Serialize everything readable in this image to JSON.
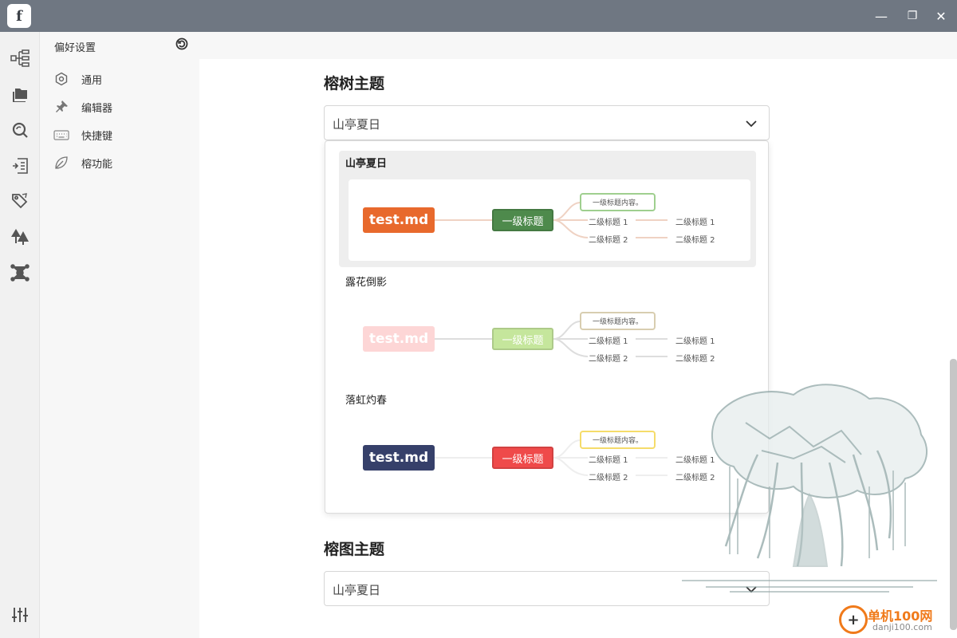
{
  "window": {
    "logo_letter": "f",
    "minimize": "—",
    "restore": "❐",
    "close": "✕"
  },
  "rail": {
    "icons": [
      "outline-tree-icon",
      "folders-icon",
      "search-refresh-icon",
      "outline-doc-icon",
      "tag-icon",
      "forest-icon",
      "graph-icon",
      "sliders-icon"
    ]
  },
  "sidebar": {
    "title": "偏好设置",
    "items": [
      {
        "label": "通用",
        "icon": "hexagon-gear-icon"
      },
      {
        "label": "编辑器",
        "icon": "pin-icon"
      },
      {
        "label": "快捷键",
        "icon": "keyboard-icon"
      },
      {
        "label": "榕功能",
        "icon": "leaf-icon"
      }
    ]
  },
  "main": {
    "tree_theme_title": "榕树主题",
    "tree_theme_value": "山亭夏日",
    "graph_theme_title": "榕图主题",
    "graph_theme_value": "山亭夏日"
  },
  "themes": [
    {
      "name": "山亭夏日",
      "selected": true,
      "root_label": "test.md",
      "root_color": "#e8692c",
      "h1_label": "一级标题",
      "h1_color": "#4e8a4c",
      "h1_text_color": "#ffffff",
      "content_label": "一级标题内容。",
      "content_border": "#9fcf8f",
      "line_color": "#efd2c3",
      "h2": [
        "二级标题 1",
        "二级标题 2"
      ],
      "h3": [
        "二级标题 1",
        "二级标题 2"
      ]
    },
    {
      "name": "露花倒影",
      "selected": false,
      "root_label": "test.md",
      "root_color": "#fdd6d6",
      "h1_label": "一级标题",
      "h1_color": "#c5e69c",
      "h1_text_color": "#ffffff",
      "content_label": "一级标题内容。",
      "content_border": "#d8cdb0",
      "line_color": "#dddddd",
      "h2": [
        "二级标题 1",
        "二级标题 2"
      ],
      "h3": [
        "二级标题 1",
        "二级标题 2"
      ]
    },
    {
      "name": "落虹灼春",
      "selected": false,
      "root_label": "test.md",
      "root_color": "#36406a",
      "h1_label": "一级标题",
      "h1_color": "#ef4a4a",
      "h1_text_color": "#ffffff",
      "content_label": "一级标题内容。",
      "content_border": "#f5dc6a",
      "line_color": "#eeeeee",
      "h2": [
        "二级标题 1",
        "二级标题 2"
      ],
      "h3": [
        "二级标题 1",
        "二级标题 2"
      ]
    }
  ],
  "brand": {
    "name": "单机100网",
    "url": "danji100.com",
    "mark": "+"
  }
}
